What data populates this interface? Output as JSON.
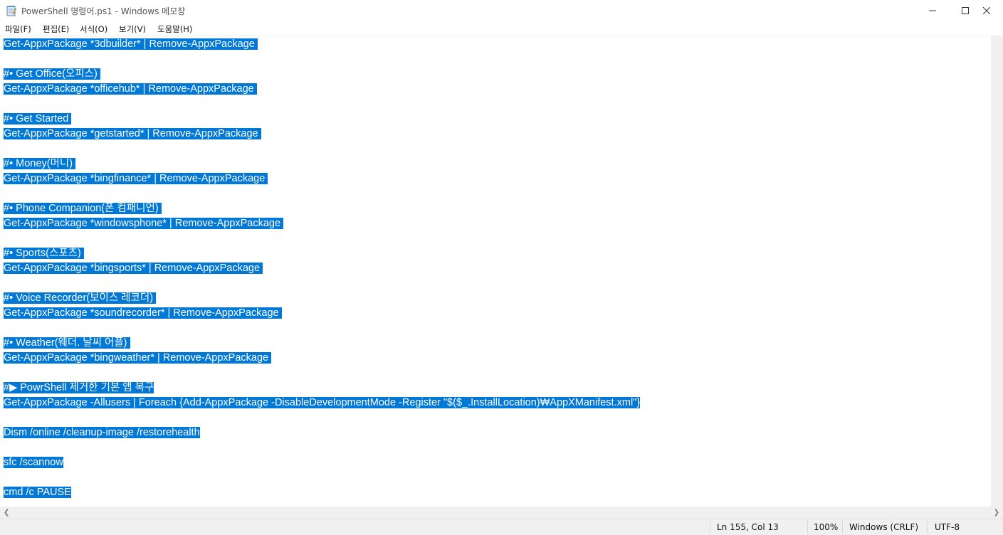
{
  "window": {
    "title": "PowerShell 명령어.ps1 - Windows 메모장"
  },
  "menu": [
    {
      "label": "파일(F)"
    },
    {
      "label": "편집(E)"
    },
    {
      "label": "서식(O)"
    },
    {
      "label": "보기(V)"
    },
    {
      "label": "도움말(H)"
    }
  ],
  "editor": {
    "lines": [
      "Get-AppxPackage *3dbuilder* | Remove-AppxPackage ",
      "#• Get Office(오피스) ",
      "Get-AppxPackage *officehub* | Remove-AppxPackage ",
      "#• Get Started ",
      "Get-AppxPackage *getstarted* | Remove-AppxPackage ",
      "#• Money(머니) ",
      "Get-AppxPackage *bingfinance* | Remove-AppxPackage ",
      "#• Phone Companion(폰 컴패니언) ",
      "Get-AppxPackage *windowsphone* | Remove-AppxPackage ",
      "#• Sports(스포츠) ",
      "Get-AppxPackage *bingsports* | Remove-AppxPackage ",
      "#• Voice Recorder(보이스 레코더) ",
      "Get-AppxPackage *soundrecorder* | Remove-AppxPackage ",
      "#• Weather(웨더. 날씨 어플) ",
      "Get-AppxPackage *bingweather* | Remove-AppxPackage ",
      "#▶ PowrShell 제거한 기본 앱 복구",
      "Get-AppxPackage -Allusers | Foreach {Add-AppxPackage -DisableDevelopmentMode -Register \"$($_.InstallLocation)₩AppXManifest.xml\"}",
      "Dism /online /cleanup-image /restorehealth",
      "sfc /scannow",
      "cmd /c PAUSE"
    ]
  },
  "status": {
    "position": "Ln 155, Col 13",
    "zoom": "100%",
    "line_ending": "Windows (CRLF)",
    "encoding": "UTF-8"
  },
  "colors": {
    "selection": "#0078d7",
    "selection_text": "#ffffff"
  }
}
